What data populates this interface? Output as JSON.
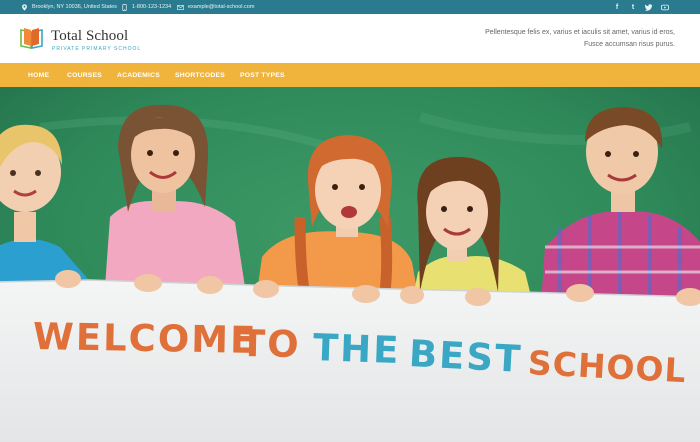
{
  "topbar": {
    "address": "Brooklyn, NY 10036, United States",
    "phone": "1-800-123-1234",
    "email": "example@total-school.com",
    "social_icons": [
      "facebook-icon",
      "tumblr-icon",
      "twitter-icon",
      "youtube-icon"
    ]
  },
  "header": {
    "site_title": "Total School",
    "tagline": "PRIVATE PRIMARY SCHOOL",
    "description": "Pellentesque felis ex, varius et iaculis sit amet, varius id eros, Fusce accumsan risus purus."
  },
  "nav": {
    "items": [
      "HOME",
      "COURSES",
      "ACADEMICS",
      "SHORTCODES",
      "POST TYPES"
    ]
  },
  "hero": {
    "banner_words": [
      "WELCOME",
      "TO",
      "THE",
      "BEST",
      "SCHOOL"
    ]
  },
  "colors": {
    "topbar": "#2b7b90",
    "nav": "#f0b43c",
    "tagline": "#3aa7c0",
    "banner_orange": "#e0703a",
    "banner_blue": "#3aa8c4",
    "chalkboard": "#2f8a5a"
  }
}
